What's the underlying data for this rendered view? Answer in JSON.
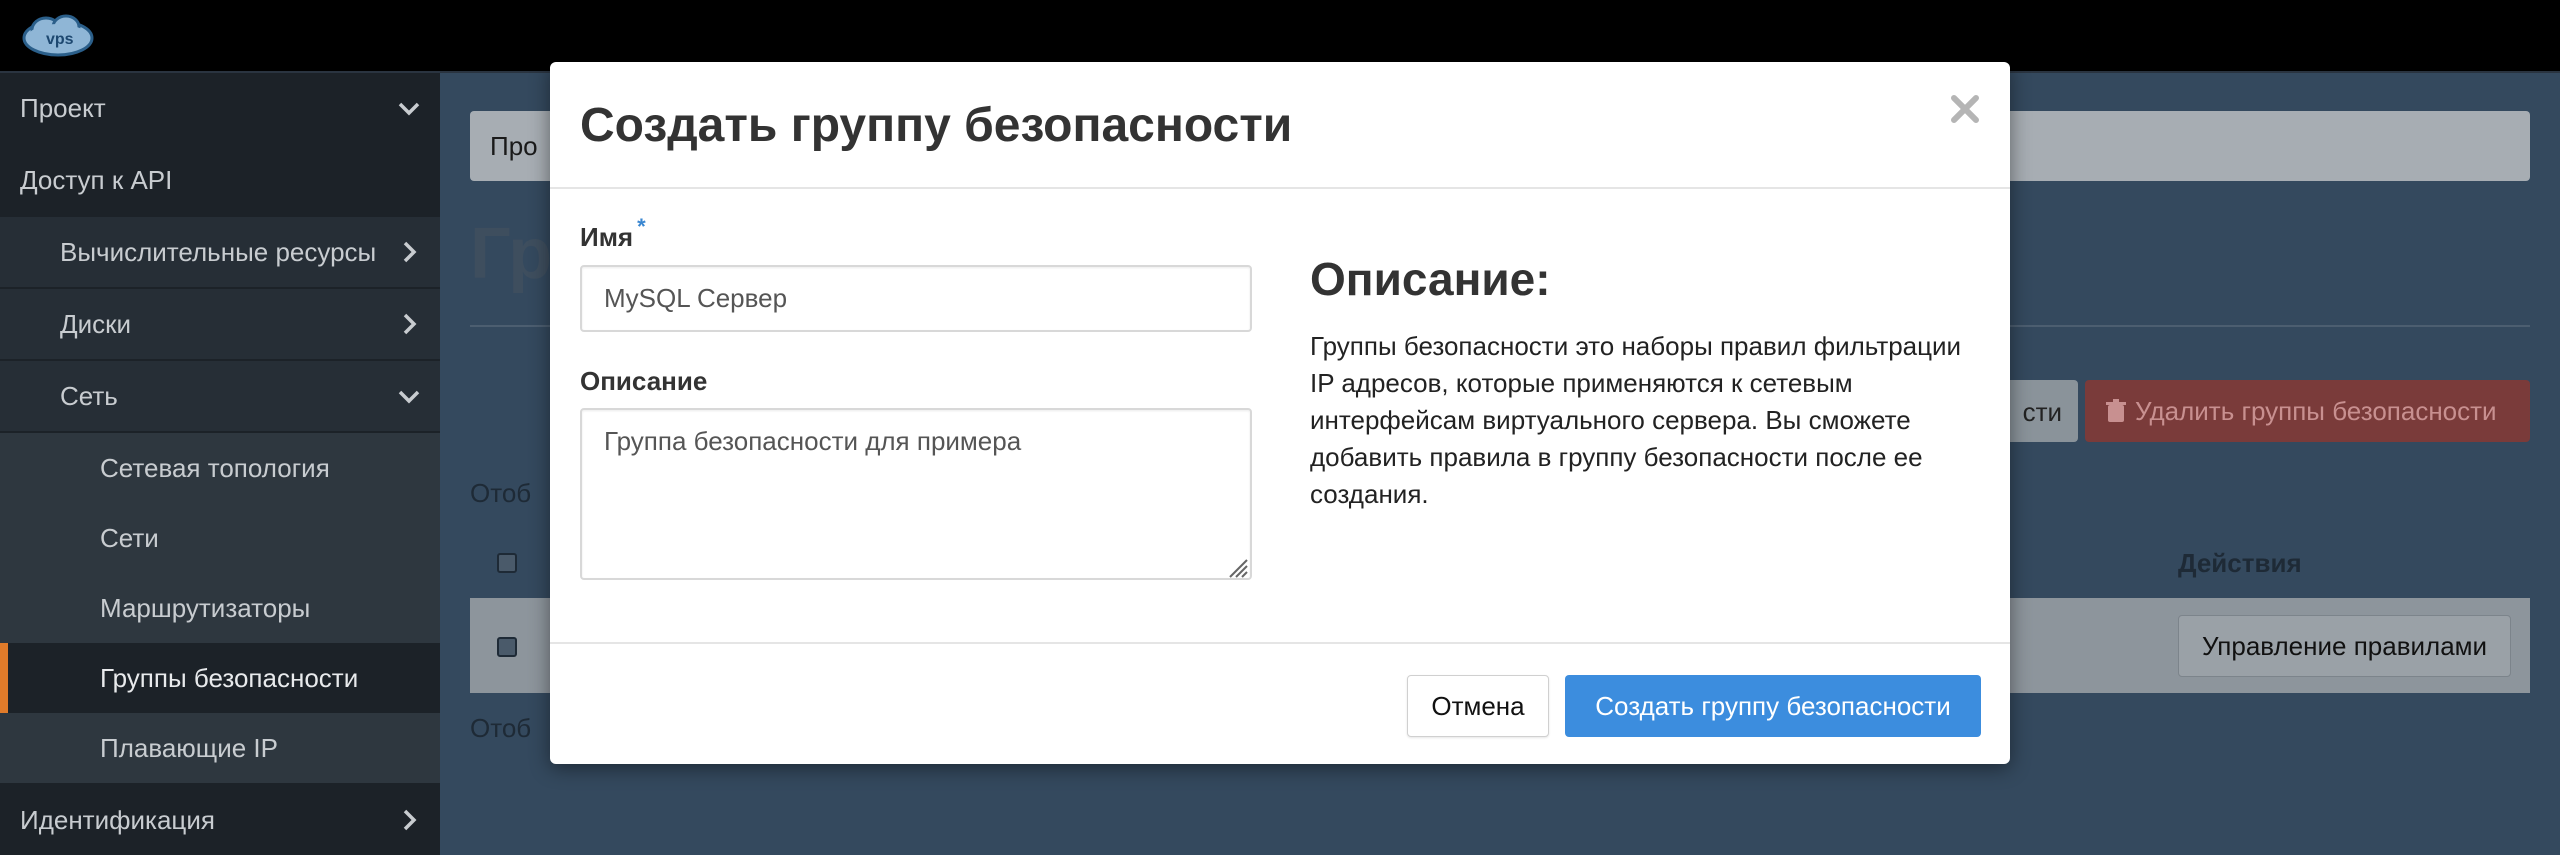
{
  "sidebar": {
    "items": [
      {
        "label": "Проект",
        "level": 0,
        "chevron": "down"
      },
      {
        "label": "Доступ к API",
        "level": 0,
        "chevron": ""
      },
      {
        "label": "Вычислительные ресурсы",
        "level": 1,
        "chevron": "right"
      },
      {
        "label": "Диски",
        "level": 1,
        "chevron": "right"
      },
      {
        "label": "Сеть",
        "level": 1,
        "chevron": "down"
      },
      {
        "label": "Сетевая топология",
        "level": 2,
        "chevron": ""
      },
      {
        "label": "Сети",
        "level": 2,
        "chevron": ""
      },
      {
        "label": "Маршрутизаторы",
        "level": 2,
        "chevron": ""
      },
      {
        "label": "Группы безопасности",
        "level": 2,
        "chevron": "",
        "active": true
      },
      {
        "label": "Плавающие IP",
        "level": 2,
        "chevron": ""
      },
      {
        "label": "Идентификация",
        "level": 0,
        "chevron": "right"
      }
    ]
  },
  "background": {
    "breadcrumb": "Про",
    "page_heading": "Гр",
    "manage_button_fragment": "сти",
    "delete_button": "Удалить группы безопасности",
    "count_text": "Отоб",
    "count_text_bottom": "Отоб",
    "actions_header": "Действия",
    "manage_rules_button": "Управление правилами"
  },
  "modal": {
    "title": "Создать группу безопасности",
    "name_label": "Имя",
    "required_mark": "*",
    "name_value": "MySQL Сервер",
    "description_label": "Описание",
    "description_value": "Группа безопасности для примера",
    "help_title": "Описание:",
    "help_text": "Группы безопасности это наборы правил фильтрации IP адресов, которые применяются к сетевым интерфейсам виртуального сервера. Вы сможете добавить правила в группу безопасности после ее создания.",
    "cancel_button": "Отмена",
    "create_button": "Создать группу безопасности"
  },
  "colors": {
    "primary": "#3c8dde",
    "active_indicator": "#e07b2a",
    "required": "#3a87d1"
  }
}
